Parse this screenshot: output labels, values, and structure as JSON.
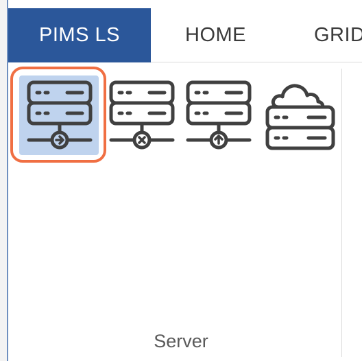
{
  "tabs": [
    {
      "label": "PIMS LS",
      "active": true
    },
    {
      "label": "HOME",
      "active": false
    },
    {
      "label": "GRID",
      "active": false
    }
  ],
  "ribbon": {
    "group_label": "Server",
    "buttons": [
      {
        "icon": "server-connect-icon",
        "selected": true
      },
      {
        "icon": "server-disconnect-icon",
        "selected": false
      },
      {
        "icon": "server-upload-icon",
        "selected": false
      },
      {
        "icon": "cloud-server-icon",
        "selected": false
      }
    ]
  },
  "colors": {
    "active_tab": "#2b579a",
    "selection_fill": "#bfd3ee",
    "selection_border": "#f06f43"
  }
}
